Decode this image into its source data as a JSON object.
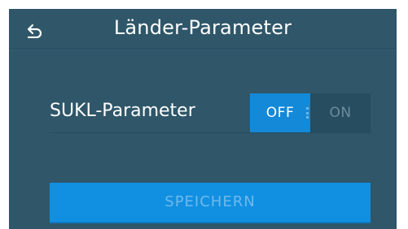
{
  "header": {
    "back_icon": "back-arrow-icon",
    "title": "Länder-Parameter"
  },
  "setting": {
    "label": "SUKL-Parameter",
    "toggle": {
      "off_label": "OFF",
      "on_label": "ON",
      "selected": "OFF"
    }
  },
  "actions": {
    "save_label": "SPEICHERN",
    "save_enabled": false
  },
  "colors": {
    "background": "#2f5669",
    "accent": "#1489d8",
    "text": "#ffffff"
  }
}
